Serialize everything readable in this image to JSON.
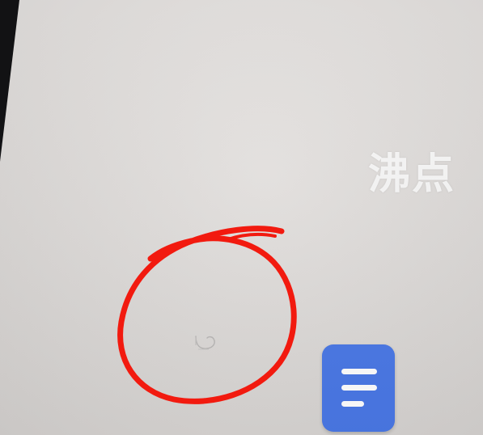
{
  "watermark": {
    "text": "沸点"
  },
  "icons": {
    "document_app": "document-icon",
    "faint_app": "circle-app-icon"
  },
  "colors": {
    "annotation_circle": "#f21a0f",
    "document_app_bg": "#4a78e6",
    "screen_bg": "#dddad8"
  }
}
